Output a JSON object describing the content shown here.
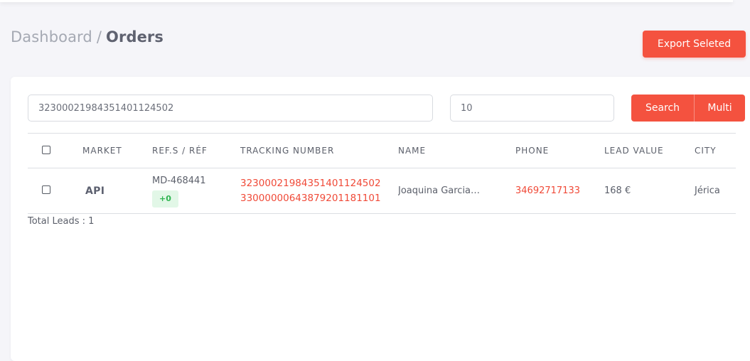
{
  "breadcrumb": {
    "parent": "Dashboard",
    "separator": "/",
    "current": "Orders"
  },
  "toolbar": {
    "export_label": "Export Seleted"
  },
  "filters": {
    "search_value": "32300021984351401124502",
    "limit_value": "10",
    "search_label": "Search",
    "multi_label": "Multi"
  },
  "table": {
    "columns": [
      "MARKET",
      "REF.S / RÉF",
      "TRACKING NUMBER",
      "NAME",
      "PHONE",
      "LEAD VALUE",
      "CITY"
    ],
    "rows": [
      {
        "market": "API",
        "ref": "MD-468441",
        "ref_badge": "+0",
        "tracking_primary": "32300021984351401124502",
        "tracking_secondary": "33000000643879201181101",
        "name": "Joaquina Garcia…",
        "phone": "34692717133",
        "lead_value": "168 €",
        "city": "Jérica"
      }
    ]
  },
  "summary": {
    "total_leads": "Total Leads : 1"
  },
  "colors": {
    "accent": "#f4523f",
    "link": "#f04a38",
    "badge_bg": "#e2f7e7",
    "badge_text": "#2fb551",
    "background": "#f5f5f9"
  }
}
